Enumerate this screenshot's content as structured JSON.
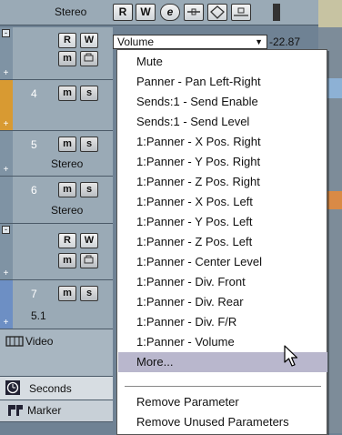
{
  "top_track": {
    "name": "Stereo",
    "buttons": [
      "R",
      "W",
      "e"
    ]
  },
  "param_row": {
    "buttons": [
      "R",
      "W"
    ],
    "selected": "Volume",
    "value": "-22.87"
  },
  "tracks": [
    {
      "num": "4",
      "name": ""
    },
    {
      "num": "5",
      "name": "Stereo"
    },
    {
      "num": "6",
      "name": "Stereo"
    },
    {
      "num": "7",
      "name": "5.1"
    }
  ],
  "buttons": {
    "mute": "m",
    "solo": "s",
    "read": "R",
    "write": "W"
  },
  "video_track": {
    "label": "Video"
  },
  "seconds_track": {
    "label": "Seconds"
  },
  "marker_track": {
    "label": "Marker"
  },
  "context_menu": {
    "items": [
      "Mute",
      "Panner - Pan Left-Right",
      "Sends:1 - Send Enable",
      "Sends:1 - Send Level",
      "1:Panner - X Pos. Right",
      "1:Panner - Y Pos. Right",
      "1:Panner - Z Pos. Right",
      "1:Panner - X Pos. Left",
      "1:Panner - Y Pos. Left",
      "1:Panner - Z Pos. Left",
      "1:Panner - Center Level",
      "1:Panner - Div. Front",
      "1:Panner - Div. Rear",
      "1:Panner - Div. F/R",
      "1:Panner - Volume",
      "More..."
    ],
    "footer_items": [
      "Remove Parameter",
      "Remove Unused Parameters"
    ],
    "highlighted": "More..."
  },
  "colors": {
    "track_bg": "#9aaab6",
    "menu_highlight": "#b9b7cd",
    "orange_track": "#d89a32"
  }
}
